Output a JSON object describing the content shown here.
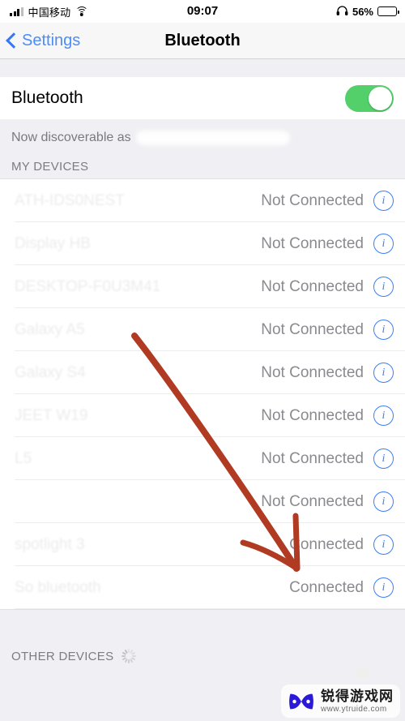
{
  "status_bar": {
    "carrier": "中国移动",
    "time": "09:07",
    "battery_percent": "56%",
    "battery_level": 56,
    "signal_bars": 3,
    "icons": [
      "signal-bars-icon",
      "wifi-icon",
      "headphones-icon",
      "battery-icon"
    ],
    "headphones_glyph": "♪",
    "battery_color": "#FDCB2E"
  },
  "nav": {
    "back_label": "Settings",
    "title": "Bluetooth"
  },
  "bluetooth": {
    "label": "Bluetooth",
    "toggle_on": true,
    "toggle_color": "#53D06A",
    "discoverable_prefix": "Now discoverable as",
    "discoverable_name_redacted": true
  },
  "sections": {
    "my_devices_header": "MY DEVICES",
    "other_devices_header": "OTHER DEVICES",
    "other_devices_scanning": true
  },
  "devices": [
    {
      "name": "ATH-IDS0NEST",
      "status": "Not Connected",
      "info": "i"
    },
    {
      "name": "Display HB",
      "status": "Not Connected",
      "info": "i"
    },
    {
      "name": "DESKTOP-F0U3M41",
      "status": "Not Connected",
      "info": "i"
    },
    {
      "name": "Galaxy A5",
      "status": "Not Connected",
      "info": "i"
    },
    {
      "name": "Galaxy S4",
      "status": "Not Connected",
      "info": "i"
    },
    {
      "name": "JEET W19",
      "status": "Not Connected",
      "info": "i"
    },
    {
      "name": "L5",
      "status": "Not Connected",
      "info": "i"
    },
    {
      "name": "",
      "status": "Not Connected",
      "info": "i"
    },
    {
      "name": "spotlight  3",
      "status": "Connected",
      "info": "i"
    },
    {
      "name": "So       bluetooth",
      "status": "Connected",
      "info": "i"
    }
  ],
  "annotation": {
    "type": "hand-drawn-arrow",
    "color": "#B03A22",
    "points_to_row_index": 8
  },
  "watermark": {
    "site_name": "锐得游戏网",
    "url": "www.ytruide.com",
    "logo_color": "#2B19D8"
  }
}
